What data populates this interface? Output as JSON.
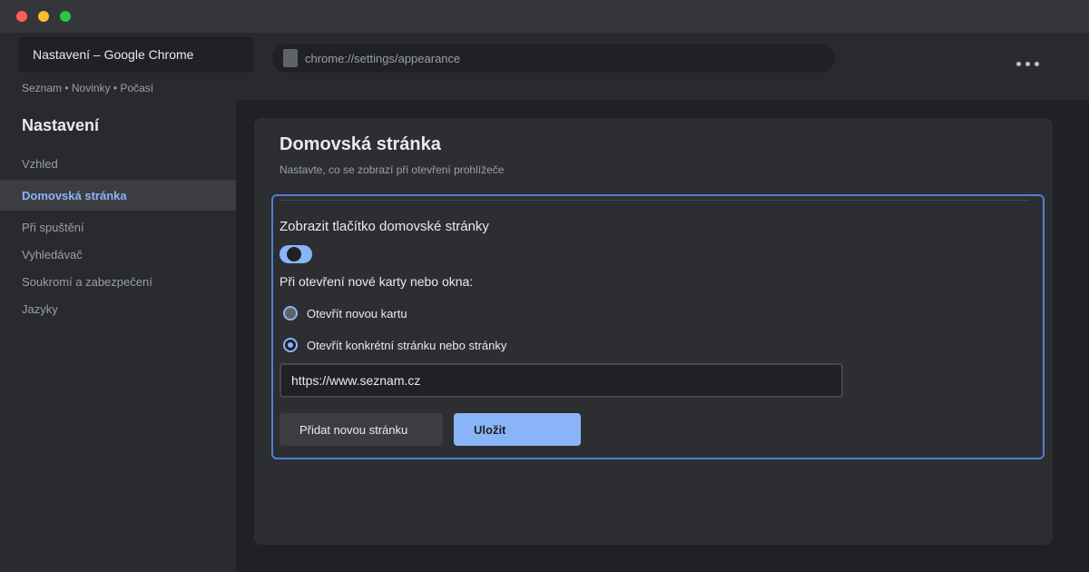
{
  "window": {
    "tab_title": "Nastavení – Google Chrome",
    "url": "chrome://settings/appearance",
    "bookmarks": "Seznam • Novinky • Počasí",
    "menu_icon": "more-dots-icon"
  },
  "sidebar": {
    "title": "Nastavení",
    "items": [
      {
        "label": "Vzhled",
        "active": false
      },
      {
        "label": "Domovská stránka",
        "active": true
      },
      {
        "label": "Při spuštění",
        "active": false
      },
      {
        "label": "Vyhledávač",
        "active": false
      },
      {
        "label": "Soukromí a zabezpečení",
        "active": false
      },
      {
        "label": "Jazyky",
        "active": false
      }
    ]
  },
  "main": {
    "title": "Domovská stránka",
    "subtitle": "Nastavte, co se zobrazí při otevření prohlížeče",
    "show_home_button_label": "Zobrazit tlačítko domovské stránky",
    "show_home_button_enabled": true,
    "open_label": "Při otevření nové karty nebo okna:",
    "options": [
      {
        "label": "Otevřít novou kartu",
        "selected": false
      },
      {
        "label": "Otevřít konkrétní stránku nebo stránky",
        "selected": true
      }
    ],
    "url_value": "https://www.seznam.cz",
    "add_page_button": "Přidat novou stránku",
    "save_button": "Uložit"
  },
  "colors": {
    "accent": "#8ab4f8",
    "panel_border": "#4e7fd6",
    "background": "#202124"
  }
}
